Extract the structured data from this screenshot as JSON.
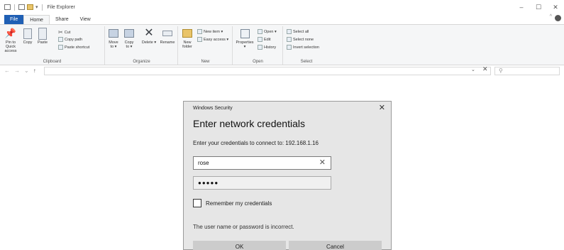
{
  "window": {
    "title": "File Explorer",
    "controls": {
      "minimize": "–",
      "maximize": "☐",
      "close": "✕"
    }
  },
  "ribbon_tabs": [
    "File",
    "Home",
    "Share",
    "View"
  ],
  "ribbon": {
    "clipboard": {
      "label": "Clipboard",
      "pin": "Pin to Quick access",
      "copy": "Copy",
      "paste": "Paste",
      "cut": "Cut",
      "copy_path": "Copy path",
      "paste_shortcut": "Paste shortcut"
    },
    "organize": {
      "label": "Organize",
      "move_to": "Move to ▾",
      "copy_to": "Copy to ▾",
      "delete": "Delete ▾",
      "rename": "Rename"
    },
    "new": {
      "label": "New",
      "new_folder": "New folder",
      "new_item": "New item ▾",
      "easy_access": "Easy access ▾"
    },
    "open": {
      "label": "Open",
      "properties": "Properties ▾",
      "open": "Open ▾",
      "edit": "Edit",
      "history": "History"
    },
    "select": {
      "label": "Select",
      "select_all": "Select all",
      "select_none": "Select none",
      "invert_selection": "Invert selection"
    }
  },
  "address_bar": {
    "path": "",
    "search_placeholder": ""
  },
  "dialog": {
    "title": "Windows Security",
    "heading": "Enter network credentials",
    "prompt": "Enter your credentials to connect to: 192.168.1.16",
    "username_value": "rose",
    "password_value": "●●●●●",
    "remember_label": "Remember my credentials",
    "remember_checked": false,
    "error": "The user name or password is incorrect.",
    "ok_label": "OK",
    "cancel_label": "Cancel"
  }
}
